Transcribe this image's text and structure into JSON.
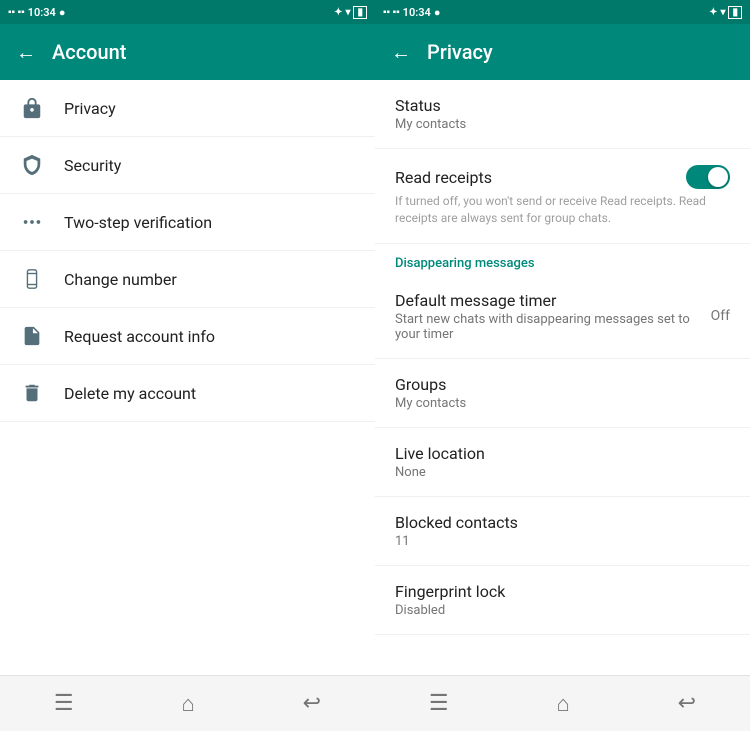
{
  "account_panel": {
    "status_bar": {
      "time": "10:34",
      "left_icons": "4G 4G",
      "right_icons": "BT WiFi Bat"
    },
    "title": "Account",
    "back_label": "←",
    "menu_items": [
      {
        "id": "privacy",
        "label": "Privacy",
        "icon": "lock"
      },
      {
        "id": "security",
        "label": "Security",
        "icon": "shield"
      },
      {
        "id": "two-step",
        "label": "Two-step verification",
        "icon": "dots"
      },
      {
        "id": "change-number",
        "label": "Change number",
        "icon": "phone"
      },
      {
        "id": "request-info",
        "label": "Request account info",
        "icon": "doc"
      },
      {
        "id": "delete-account",
        "label": "Delete my account",
        "icon": "trash"
      }
    ],
    "bottom_nav": {
      "menu_icon": "☰",
      "home_icon": "⌂",
      "back_icon": "↩"
    }
  },
  "privacy_panel": {
    "status_bar": {
      "time": "10:34",
      "left_icons": "4G 4G",
      "right_icons": "BT WiFi Bat"
    },
    "title": "Privacy",
    "back_label": "←",
    "items": [
      {
        "id": "status",
        "title": "Status",
        "sub": "My contacts",
        "toggle": false
      },
      {
        "id": "read-receipts",
        "title": "Read receipts",
        "sub": "",
        "desc": "If turned off, you won't send or receive Read receipts. Read receipts are always sent for group chats.",
        "toggle": true
      },
      {
        "id": "section-disappearing",
        "section": true,
        "label": "Disappearing messages"
      },
      {
        "id": "default-timer",
        "title": "Default message timer",
        "sub": "Start new chats with disappearing messages set to your timer",
        "value": "Off",
        "toggle": false
      },
      {
        "id": "groups",
        "title": "Groups",
        "sub": "My contacts",
        "toggle": false
      },
      {
        "id": "live-location",
        "title": "Live location",
        "sub": "None",
        "toggle": false
      },
      {
        "id": "blocked-contacts",
        "title": "Blocked contacts",
        "sub": "11",
        "toggle": false
      },
      {
        "id": "fingerprint-lock",
        "title": "Fingerprint lock",
        "sub": "Disabled",
        "toggle": false
      }
    ],
    "bottom_nav": {
      "menu_icon": "☰",
      "home_icon": "⌂",
      "back_icon": "↩"
    }
  }
}
